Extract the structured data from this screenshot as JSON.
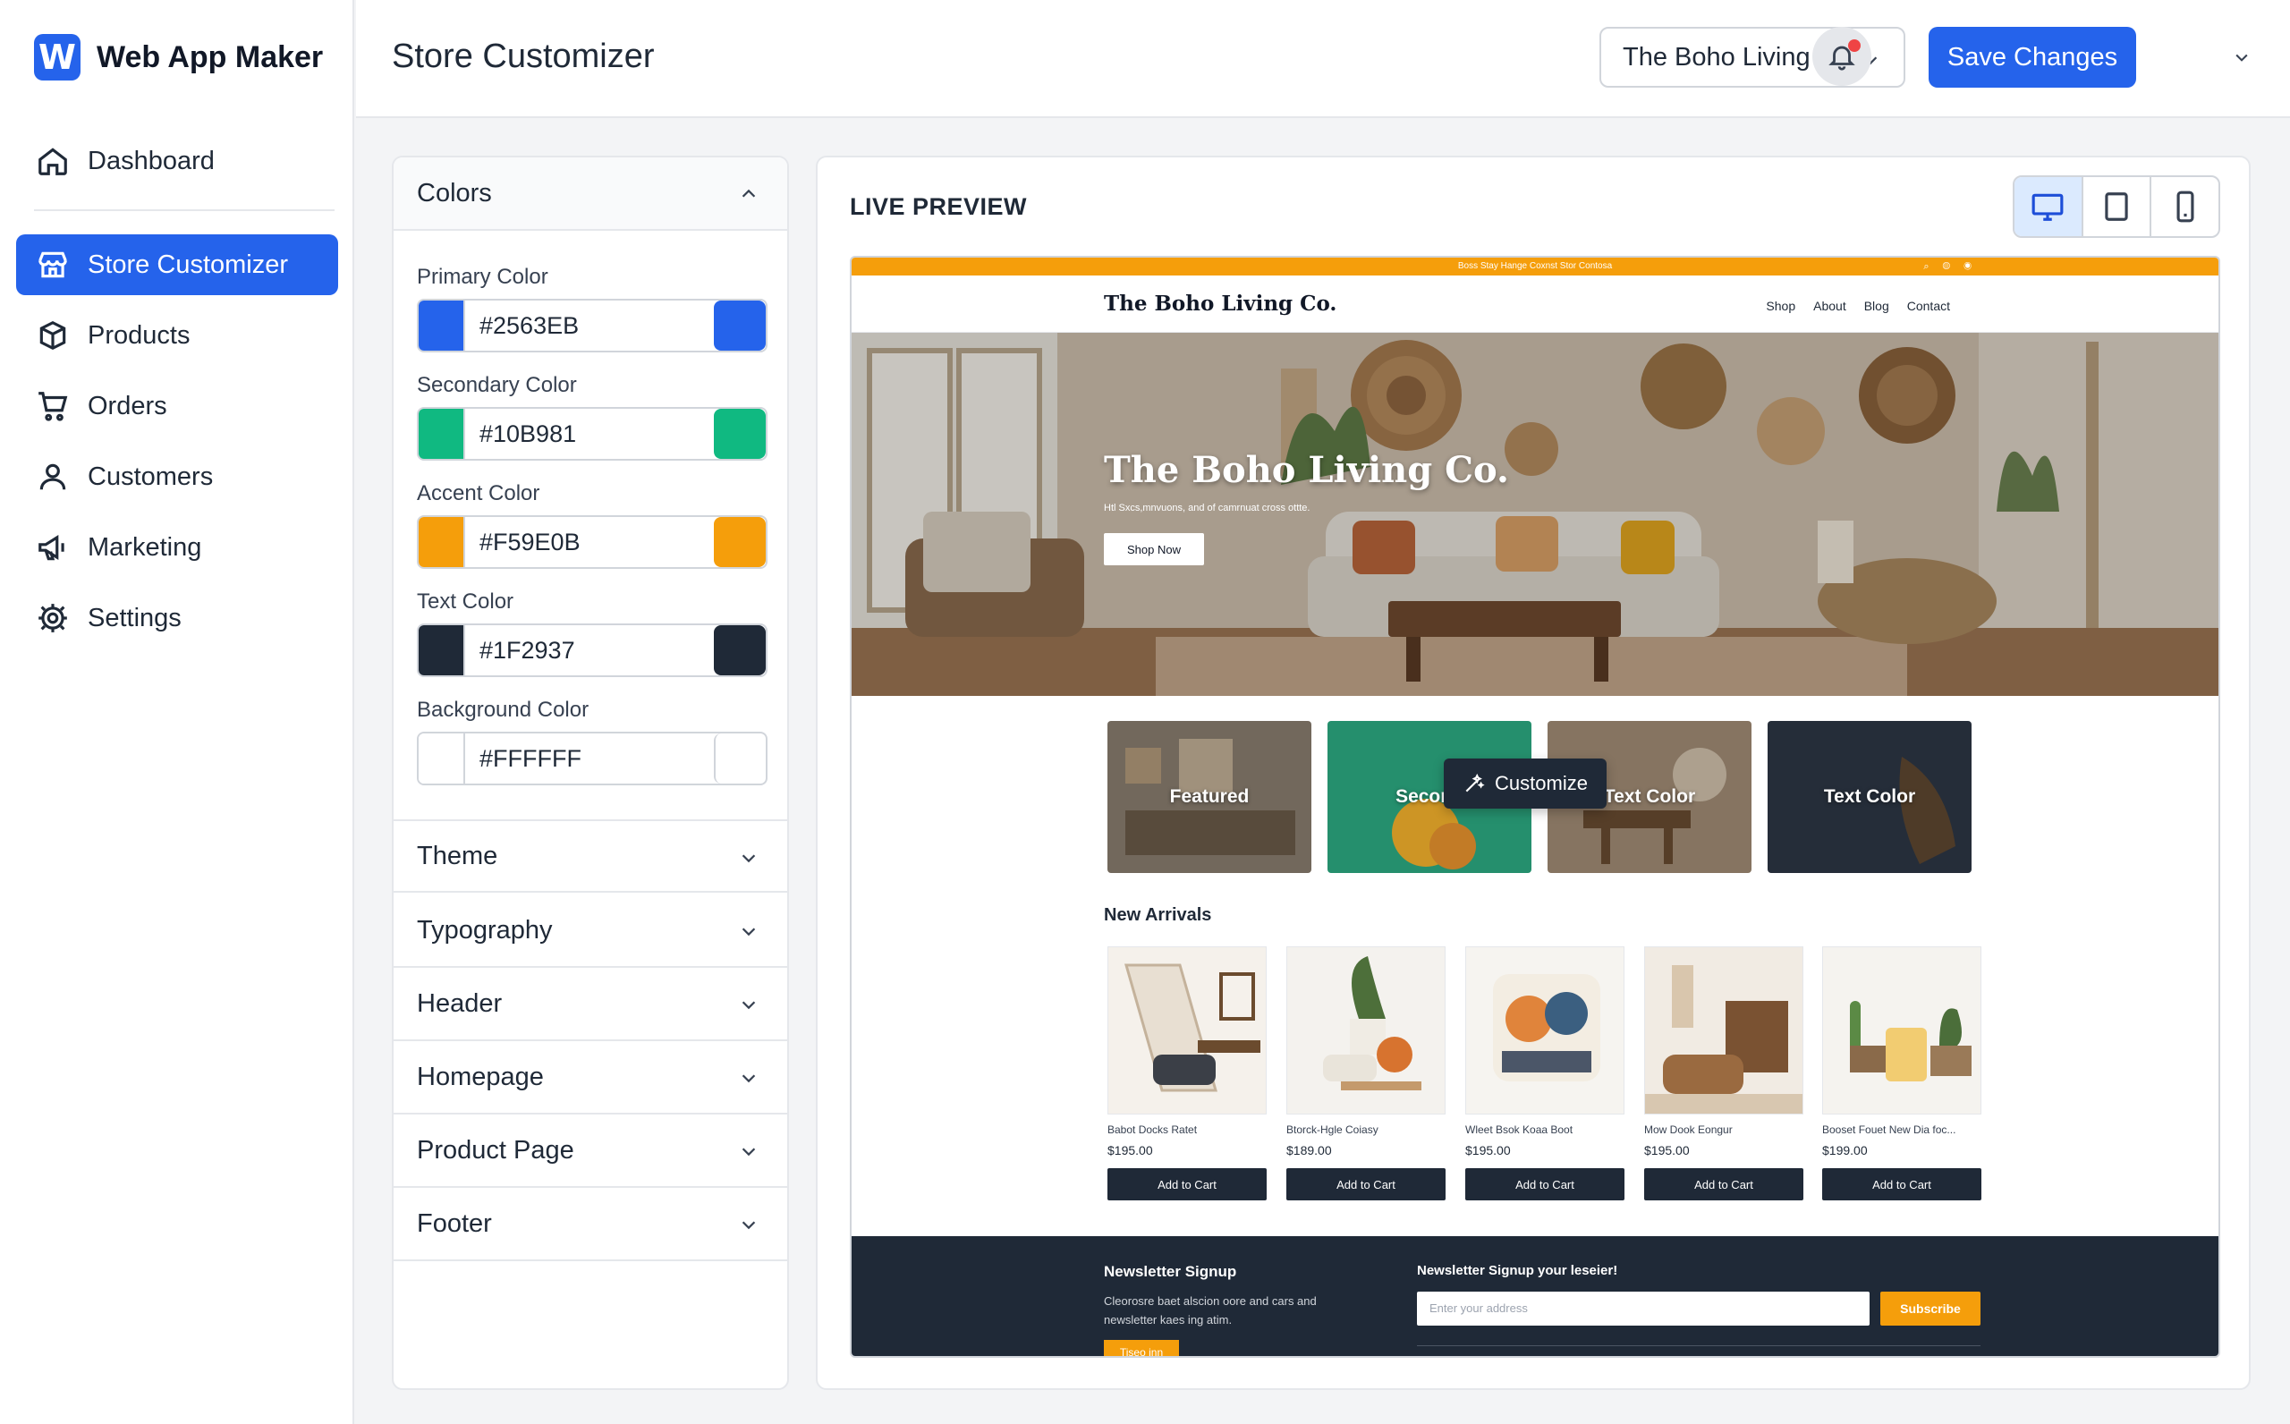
{
  "app": {
    "logo_letter": "W",
    "name": "Web App Maker"
  },
  "sidebar": {
    "items": [
      {
        "label": "Dashboard",
        "icon": "home-icon"
      },
      {
        "label": "Store Customizer",
        "icon": "store-icon",
        "active": true
      },
      {
        "label": "Products",
        "icon": "box-icon"
      },
      {
        "label": "Orders",
        "icon": "cart-icon"
      },
      {
        "label": "Customers",
        "icon": "user-icon"
      },
      {
        "label": "Marketing",
        "icon": "megaphone-icon"
      },
      {
        "label": "Settings",
        "icon": "gear-icon"
      }
    ]
  },
  "header": {
    "title": "Store Customizer",
    "store_select": "The Boho Living Co.",
    "save_label": "Save Changes",
    "notification_badge": true
  },
  "customizer": {
    "colors_heading": "Colors",
    "colors": [
      {
        "label": "Primary Color",
        "hex": "#2563EB"
      },
      {
        "label": "Secondary Color",
        "hex": "#10B981"
      },
      {
        "label": "Accent Color",
        "hex": "#F59E0B"
      },
      {
        "label": "Text Color",
        "hex": "#1F2937"
      },
      {
        "label": "Background Color",
        "hex": "#FFFFFF"
      }
    ],
    "sections": [
      "Theme",
      "Typography",
      "Header",
      "Homepage",
      "Product Page",
      "Footer"
    ]
  },
  "preview": {
    "title": "LIVE PREVIEW",
    "devices": [
      "desktop-icon",
      "tablet-icon",
      "mobile-icon"
    ],
    "active_device": "desktop",
    "site": {
      "announcement": "Boss Stay Hange Coxnst Stor Contosa",
      "brand": "The Boho Living Co.",
      "nav": [
        "Shop",
        "About",
        "Blog",
        "Contact"
      ],
      "hero_title": "The Boho Living Co.",
      "hero_subtitle": "Htl Sxcs,mnvuons, and of camrnuat cross ottte.",
      "hero_button": "Shop Now",
      "categories": [
        "Featured",
        "Second",
        "Text Color",
        "Text Color"
      ],
      "customize_tooltip": "Customize",
      "new_arrivals_title": "New Arrivals",
      "products": [
        {
          "name": "Babot Docks Ratet",
          "price": "$195.00",
          "button": "Add to Cart"
        },
        {
          "name": "Btorck-Hgle Coiasy",
          "price": "$189.00",
          "button": "Add to Cart"
        },
        {
          "name": "Wleet Bsok Koaa Boot",
          "price": "$195.00",
          "button": "Add to Cart"
        },
        {
          "name": "Mow Dook Eongur",
          "price": "$195.00",
          "button": "Add to Cart"
        },
        {
          "name": "Booset Fouet New Dia foc...",
          "price": "$199.00",
          "button": "Add to Cart"
        }
      ],
      "footer": {
        "newsletter_heading": "Newsletter Signup",
        "newsletter_text": "Cleorosre baet alscion oore and cars and newsletter kaes ing atim.",
        "small_button": "Tiseo inn",
        "signup_heading": "Newsletter Signup your leseier!",
        "email_placeholder": "Enter your address",
        "subscribe_label": "Subscribe"
      }
    }
  },
  "colors": {
    "primary": "#2563eb",
    "secondary": "#10b981",
    "accent": "#f59e0b",
    "text": "#1f2937",
    "background": "#ffffff"
  }
}
